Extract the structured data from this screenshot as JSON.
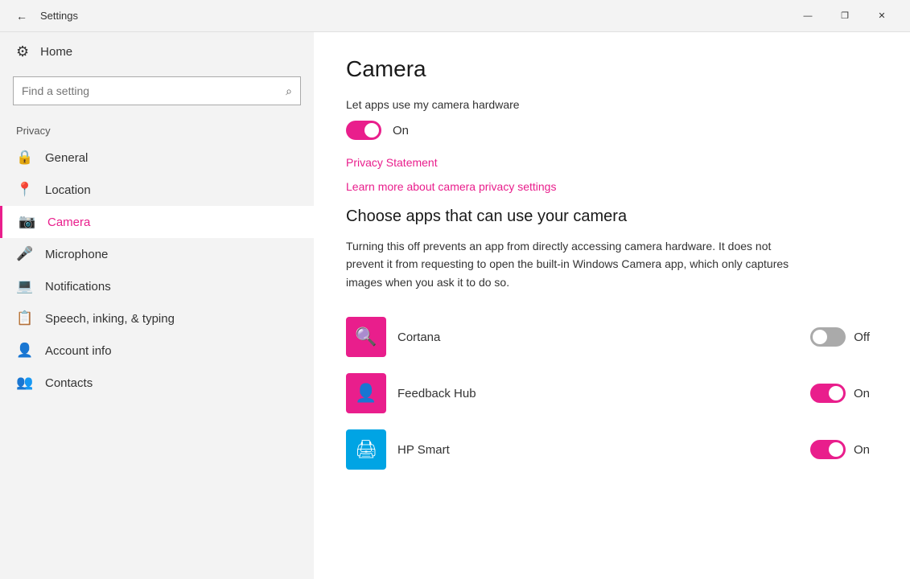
{
  "titlebar": {
    "title": "Settings",
    "back_icon": "←",
    "minimize_icon": "—",
    "restore_icon": "❐",
    "close_icon": "✕"
  },
  "sidebar": {
    "home_label": "Home",
    "home_icon": "⚙",
    "search_placeholder": "Find a setting",
    "search_icon": "🔍",
    "privacy_label": "Privacy",
    "nav_items": [
      {
        "id": "general",
        "label": "General",
        "icon": "🔒"
      },
      {
        "id": "location",
        "label": "Location",
        "icon": "📍"
      },
      {
        "id": "camera",
        "label": "Camera",
        "icon": "📷",
        "active": true
      },
      {
        "id": "microphone",
        "label": "Microphone",
        "icon": "🎤"
      },
      {
        "id": "notifications",
        "label": "Notifications",
        "icon": "🖥"
      },
      {
        "id": "speech",
        "label": "Speech, inking, & typing",
        "icon": "📋"
      },
      {
        "id": "account",
        "label": "Account info",
        "icon": "👤"
      },
      {
        "id": "contacts",
        "label": "Contacts",
        "icon": "👥"
      }
    ]
  },
  "content": {
    "page_title": "Camera",
    "let_apps_label": "Let apps use my camera hardware",
    "toggle_on_label": "On",
    "privacy_statement_link": "Privacy Statement",
    "learn_more_link": "Learn more about camera privacy settings",
    "choose_apps_heading": "Choose apps that can use your camera",
    "description": "Turning this off prevents an app from directly accessing camera hardware. It does not prevent it from requesting to open the built-in Windows Camera app, which only captures images when you ask it to do so.",
    "apps": [
      {
        "name": "Cortana",
        "toggle_state": "off",
        "toggle_label": "Off",
        "icon_color": "#e91e8c",
        "icon_symbol": "🔍"
      },
      {
        "name": "Feedback Hub",
        "toggle_state": "on",
        "toggle_label": "On",
        "icon_color": "#e91e8c",
        "icon_symbol": "👤"
      },
      {
        "name": "HP Smart",
        "toggle_state": "on",
        "toggle_label": "On",
        "icon_color": "#00a4e4",
        "icon_symbol": "🖨"
      }
    ]
  },
  "colors": {
    "accent": "#e91e8c",
    "link": "#e91e8c"
  }
}
